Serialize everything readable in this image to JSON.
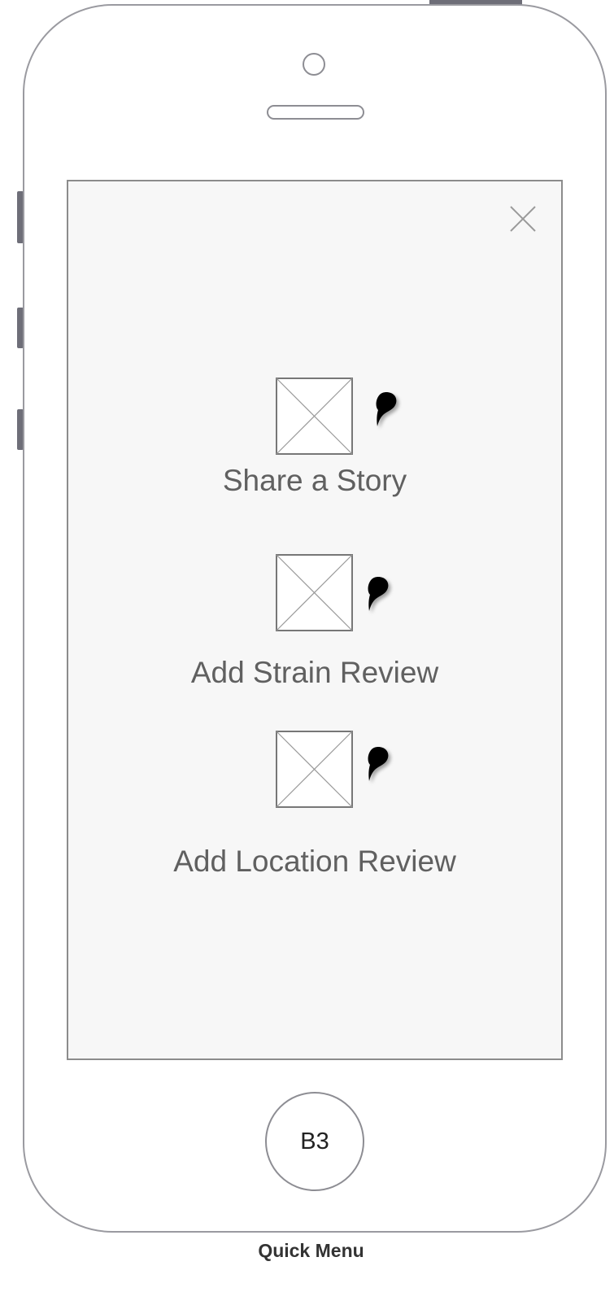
{
  "screen": {
    "close_icon": "close-icon",
    "background": "#f7f7f7"
  },
  "menu": {
    "items": [
      {
        "label": "Share a Story",
        "image_icon": "image-placeholder-icon",
        "annotation_icon": "pin-icon"
      },
      {
        "label": "Add Strain Review",
        "image_icon": "image-placeholder-icon",
        "annotation_icon": "pin-icon"
      },
      {
        "label": "Add Location Review",
        "image_icon": "image-placeholder-icon",
        "annotation_icon": "pin-icon"
      }
    ]
  },
  "device": {
    "home_button_label": "B3"
  },
  "caption": {
    "text": "Quick Menu"
  }
}
